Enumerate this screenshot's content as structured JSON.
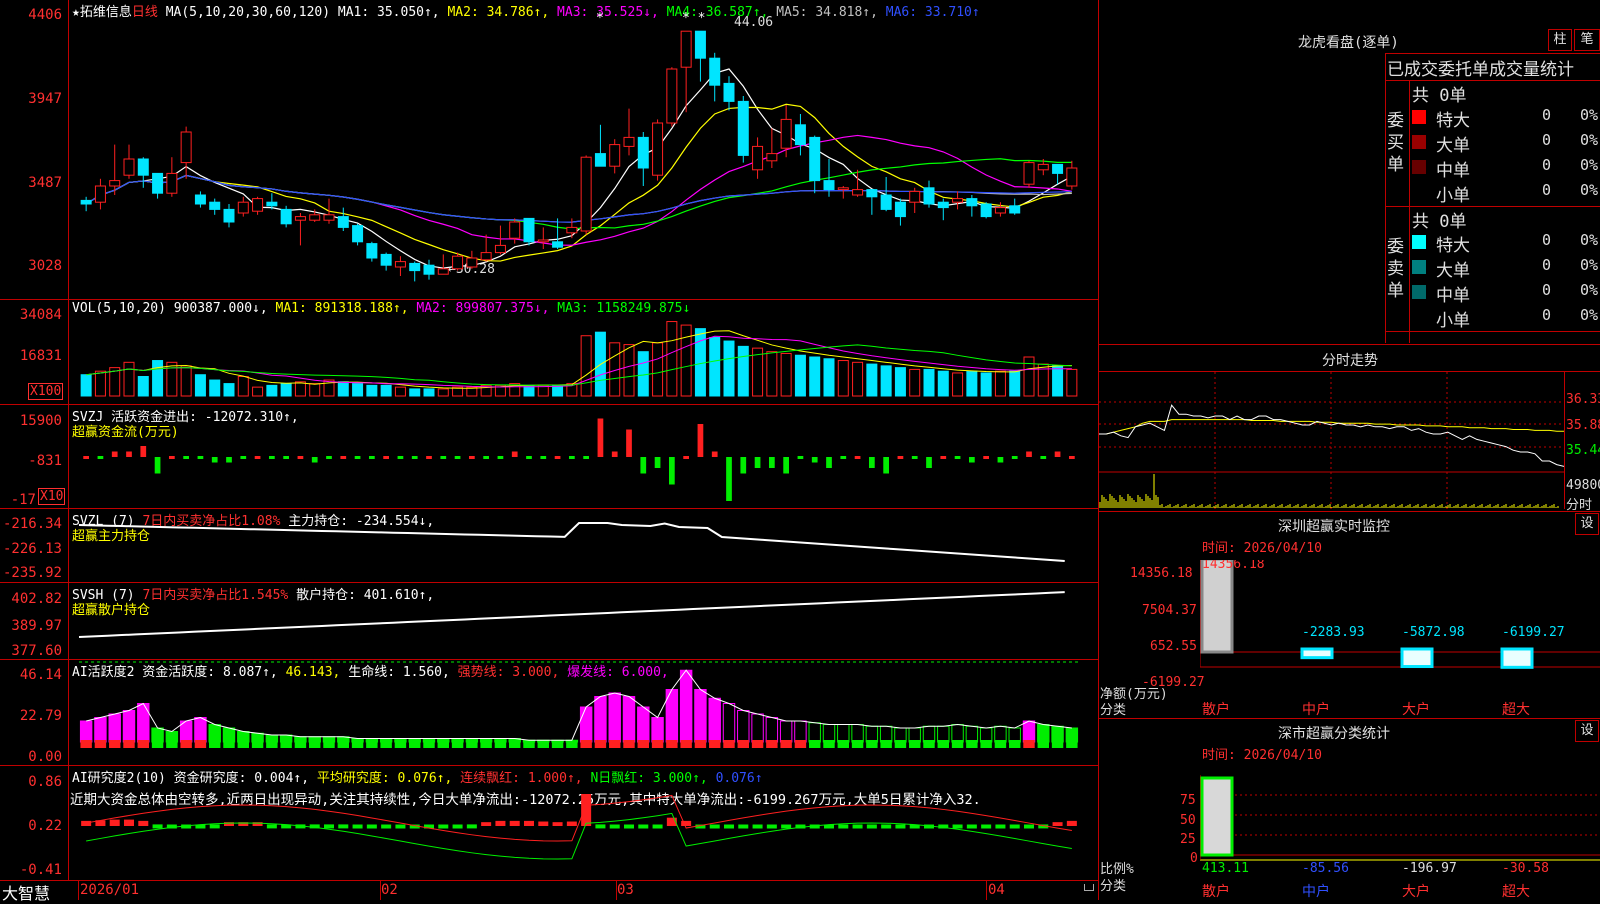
{
  "colors": {
    "up": "#ff2020",
    "down": "#00e5ff",
    "grid": "#c00000",
    "ma1": "#ffffff",
    "ma2": "#ffff00",
    "ma3": "#ff00ff",
    "ma4": "#00ff00",
    "ma5": "#c0c0c0",
    "ma6": "#3050ff",
    "green": "#00ee00",
    "magenta": "#ff00ff",
    "yellow": "#ffff00"
  },
  "main_chart": {
    "star": "★",
    "stock_name": "拓维信息",
    "period": "日线",
    "ma_params": "MA(5,10,20,30,60,120)",
    "ma1": "MA1: 35.050↑,",
    "ma2": "MA2: 34.786↑,",
    "ma3": "MA3: 35.525↓,",
    "ma4": "MA4: 36.587↑,",
    "ma5": "MA5: 34.818↑,",
    "ma6": "MA6: 33.710↑",
    "yticks": [
      "4406",
      "3947",
      "3487",
      "3028"
    ],
    "high_mark": "44.06",
    "low_mark": "←30.28",
    "star_marks": [
      "*",
      "* *"
    ]
  },
  "vol_panel": {
    "params": "VOL(5,10,20)",
    "value": "900387.000↓,",
    "ma1": "MA1: 891318.188↑,",
    "ma2": "MA2: 899807.375↓,",
    "ma3": "MA3: 1158249.875↓",
    "yticks": [
      "34084",
      "16831"
    ],
    "unit": "X100"
  },
  "svzj_panel": {
    "title": "SVZJ  活跃资金进出: -12072.310↑,",
    "subtitle": "超赢资金流(万元)",
    "yticks": [
      "15900",
      "-831",
      "-17"
    ],
    "unit": "X10"
  },
  "svzl_panel": {
    "title_a": "SVZL (7)",
    "title_b": "7日内买卖净占比1.08%",
    "title_c": "主力持仓: -234.554↓,",
    "subtitle": "超赢主力持仓",
    "yticks": [
      "-216.34",
      "-226.13",
      "-235.92"
    ]
  },
  "svsh_panel": {
    "title_a": "SVSH (7)",
    "title_b": "7日内买卖净占比1.545%",
    "title_c": "散户持仓: 401.610↑,",
    "subtitle": "超赢散户持仓",
    "yticks": [
      "402.82",
      "389.97",
      "377.60"
    ]
  },
  "ai2_panel": {
    "t1": "AI活跃度2 资金活跃度: 8.087↑,",
    "t2": "46.143,",
    "t3": "生命线: 1.560,",
    "t4": "强势线: 3.000,",
    "t5": "爆发线: 6.000,",
    "yticks": [
      "46.14",
      "22.79",
      "0.00"
    ]
  },
  "ai_research": {
    "t1": "AI研究度2(10) 资金研究度: 0.004↑,",
    "t2": "平均研究度: 0.076↑,",
    "t3": "连续飘红: 1.000↑,",
    "t4": "N日飘红: 3.000↑,",
    "t5": "0.076↑",
    "comment": "近期大资金总体由空转多,近两日出现异动,关注其持续性,今日大单净流出:-12072.25万元,其中特大单净流出:-6199.267万元,大单5日累计净入32.",
    "yticks": [
      "0.86",
      "0.22",
      "-0.41"
    ]
  },
  "x_axis": {
    "labels": [
      "2026/01",
      "02",
      "03",
      "04"
    ]
  },
  "brand": "大智慧",
  "dragon_tiger": {
    "title": "龙虎看盘(逐单)",
    "btn1": "柱",
    "btn2": "笔",
    "table_title": "已成交委托单成交量统计",
    "buy": {
      "side": "委买单",
      "total": "共 0单",
      "rows": [
        {
          "label": "特大",
          "value": "0",
          "pct": "0%",
          "color": "#ff0000"
        },
        {
          "label": "大单",
          "value": "0",
          "pct": "0%",
          "color": "#990000"
        },
        {
          "label": "中单",
          "value": "0",
          "pct": "0%",
          "color": "#660000"
        },
        {
          "label": "小单",
          "value": "0",
          "pct": "0%",
          "color": "#000000"
        }
      ]
    },
    "sell": {
      "side": "委卖单",
      "total": "共 0单",
      "rows": [
        {
          "label": "特大",
          "value": "0",
          "pct": "0%",
          "color": "#00ffff"
        },
        {
          "label": "大单",
          "value": "0",
          "pct": "0%",
          "color": "#008080"
        },
        {
          "label": "中单",
          "value": "0",
          "pct": "0%",
          "color": "#006a6a"
        },
        {
          "label": "小单",
          "value": "0",
          "pct": "0%",
          "color": "#000000"
        }
      ]
    }
  },
  "intraday": {
    "title": "分时走势",
    "yticks": [
      "36.33",
      "35.88",
      "35.44"
    ],
    "vol_tick": "49800",
    "vol_unit": "分时"
  },
  "sz_monitor": {
    "title": "深圳超赢实时监控",
    "btn": "设",
    "time": "时间: 2026/04/10",
    "yticks": [
      "14356.18",
      "7504.37",
      "652.55",
      "-6199.27"
    ],
    "ylabel": "净额(万元)",
    "xlabel": "分类",
    "bars": [
      {
        "label": "散户",
        "value": 14356.18,
        "text": "14356.18"
      },
      {
        "label": "中户",
        "value": -2283.93,
        "text": "-2283.93"
      },
      {
        "label": "大户",
        "value": -5872.98,
        "text": "-5872.98"
      },
      {
        "label": "超大",
        "value": -6199.27,
        "text": "-6199.27"
      }
    ]
  },
  "sz_class": {
    "title": "深市超赢分类统计",
    "btn": "设",
    "time": "时间: 2026/04/10",
    "yticks": [
      "75",
      "50",
      "25",
      "0"
    ],
    "ylabel": "比例%",
    "xlabel": "分类",
    "bars": [
      {
        "label": "散户",
        "value": 413.11,
        "text": "413.11"
      },
      {
        "label": "中户",
        "value": -85.56,
        "text": "-85.56"
      },
      {
        "label": "大户",
        "value": -196.97,
        "text": "-196.97"
      },
      {
        "label": "超大",
        "value": -30.58,
        "text": "-30.58"
      }
    ]
  },
  "chart_data": {
    "type": "candlestick",
    "title": "拓维信息 日线",
    "x": [
      "2026/01",
      "02",
      "03",
      "04"
    ],
    "series": [
      {
        "name": "K",
        "values": [
          [
            34.7,
            34.5,
            34.9,
            34.1
          ],
          [
            34.6,
            35.5,
            35.9,
            34.2
          ],
          [
            35.5,
            35.8,
            37.8,
            35.0
          ],
          [
            36.1,
            37.0,
            37.8,
            35.9
          ],
          [
            37.0,
            36.1,
            37.1,
            35.4
          ],
          [
            36.2,
            35.1,
            36.2,
            34.8
          ],
          [
            35.1,
            36.2,
            37.1,
            34.9
          ],
          [
            36.8,
            38.5,
            38.8,
            35.9
          ],
          [
            35.0,
            34.5,
            35.2,
            34.3
          ],
          [
            34.6,
            34.2,
            34.8,
            33.9
          ],
          [
            34.2,
            33.5,
            34.5,
            33.2
          ],
          [
            34.0,
            34.6,
            34.9,
            33.8
          ],
          [
            34.1,
            34.8,
            34.9,
            33.9
          ],
          [
            34.6,
            34.4,
            35.1,
            34.2
          ],
          [
            34.2,
            33.4,
            34.4,
            33.2
          ],
          [
            33.6,
            33.8,
            34.0,
            32.2
          ],
          [
            33.6,
            33.9,
            34.2,
            33.5
          ],
          [
            33.6,
            33.9,
            34.8,
            33.4
          ],
          [
            33.8,
            33.2,
            34.3,
            33.0
          ],
          [
            33.3,
            32.4,
            33.4,
            32.2
          ],
          [
            32.3,
            31.5,
            32.4,
            31.3
          ],
          [
            31.7,
            31.1,
            31.8,
            30.8
          ],
          [
            31.0,
            31.3,
            31.6,
            30.5
          ],
          [
            31.2,
            30.8,
            31.3,
            30.2
          ],
          [
            31.1,
            30.6,
            31.4,
            30.3
          ],
          [
            30.6,
            30.9,
            31.7,
            30.6
          ],
          [
            30.9,
            31.6,
            31.8,
            30.8
          ],
          [
            31.0,
            31.5,
            31.9,
            30.9
          ],
          [
            31.4,
            31.8,
            32.8,
            31.3
          ],
          [
            31.8,
            32.2,
            33.3,
            31.7
          ],
          [
            32.6,
            33.5,
            33.7,
            32.3
          ],
          [
            33.7,
            32.4,
            33.7,
            32.2
          ],
          [
            32.4,
            32.5,
            33.2,
            32.0
          ],
          [
            32.4,
            32.1,
            33.7,
            32.0
          ],
          [
            32.9,
            33.2,
            33.7,
            32.6
          ],
          [
            33.0,
            37.1,
            37.2,
            32.8
          ],
          [
            37.3,
            36.6,
            38.9,
            36.6
          ],
          [
            36.6,
            37.8,
            38.1,
            36.2
          ],
          [
            37.7,
            38.2,
            39.8,
            37.2
          ],
          [
            38.2,
            36.5,
            38.5,
            35.5
          ],
          [
            36.1,
            39.0,
            39.2,
            35.8
          ],
          [
            39.0,
            42.0,
            42.1,
            38.8
          ],
          [
            42.1,
            44.1,
            44.1,
            39.6
          ],
          [
            44.1,
            42.6,
            44.1,
            41.3
          ],
          [
            42.6,
            41.1,
            42.9,
            40.2
          ],
          [
            41.2,
            40.2,
            41.6,
            39.7
          ],
          [
            40.2,
            37.2,
            40.5,
            36.8
          ],
          [
            36.4,
            37.7,
            38.2,
            35.9
          ],
          [
            36.9,
            37.3,
            38.7,
            36.5
          ],
          [
            37.6,
            39.2,
            40.0,
            37.1
          ],
          [
            38.9,
            37.8,
            39.5,
            37.2
          ],
          [
            38.2,
            35.8,
            38.3,
            35.1
          ],
          [
            35.8,
            35.3,
            37.0,
            34.9
          ],
          [
            35.3,
            35.4,
            35.5,
            34.8
          ],
          [
            35.0,
            35.3,
            36.4,
            34.9
          ],
          [
            35.3,
            34.9,
            35.3,
            33.9
          ],
          [
            35.0,
            34.2,
            36.0,
            34.1
          ],
          [
            34.6,
            33.8,
            34.8,
            33.3
          ],
          [
            34.6,
            35.2,
            35.4,
            34.0
          ],
          [
            35.4,
            34.5,
            35.8,
            34.3
          ],
          [
            34.6,
            34.3,
            34.8,
            33.6
          ],
          [
            34.6,
            34.8,
            35.2,
            34.2
          ],
          [
            34.8,
            34.4,
            35.0,
            33.8
          ],
          [
            34.5,
            33.8,
            34.6,
            33.7
          ],
          [
            34.0,
            34.3,
            34.6,
            33.8
          ],
          [
            34.4,
            34.0,
            34.8,
            33.9
          ],
          [
            35.6,
            36.8,
            36.9,
            35.4
          ],
          [
            36.4,
            36.7,
            37.0,
            36.1
          ],
          [
            36.7,
            36.2,
            36.7,
            35.6
          ],
          [
            35.5,
            36.5,
            36.9,
            35.3
          ]
        ]
      }
    ],
    "ylim": [
      30.28,
      44.06
    ]
  },
  "vol_data": [
    12,
    14,
    16,
    19,
    11,
    20,
    19,
    17,
    12,
    9,
    7,
    11,
    5,
    6,
    7,
    8,
    7,
    9,
    8,
    7,
    6,
    6,
    5,
    4,
    4,
    4,
    5,
    5,
    6,
    6,
    7,
    6,
    6,
    6,
    7,
    34,
    36,
    30,
    29,
    25,
    30,
    42,
    40,
    38,
    33,
    31,
    28,
    27,
    25,
    24,
    23,
    22,
    21,
    20,
    19,
    18,
    17,
    16,
    15,
    15,
    14,
    13,
    14,
    13,
    14,
    14,
    22,
    18,
    17,
    15
  ],
  "svzj_data": [
    0,
    0,
    1,
    1,
    2,
    -3,
    0,
    0,
    0,
    -1,
    -1,
    0,
    0,
    0,
    0,
    0,
    -1,
    0,
    0,
    0,
    0,
    0,
    0,
    0,
    0,
    0,
    0,
    0,
    0,
    0,
    1,
    0,
    0,
    0,
    0,
    0,
    7,
    1,
    5,
    -3,
    -2,
    -5,
    0,
    6,
    1,
    -8,
    -3,
    -2,
    -2,
    -3,
    0,
    -1,
    -2,
    0,
    0,
    -2,
    -3,
    0,
    0,
    -2,
    0,
    0,
    -1,
    0,
    -1,
    0,
    1,
    0,
    1,
    0
  ],
  "ai2_data": [
    12,
    14,
    16,
    18,
    22,
    8,
    6,
    12,
    14,
    10,
    8,
    6,
    5,
    4,
    4,
    3,
    3,
    3,
    3,
    2,
    2,
    2,
    2,
    2,
    2,
    2,
    2,
    2,
    2,
    2,
    2,
    1,
    1,
    1,
    1,
    20,
    26,
    28,
    26,
    20,
    14,
    30,
    41,
    30,
    25,
    22,
    18,
    16,
    14,
    12,
    12,
    11,
    10,
    10,
    10,
    9,
    9,
    8,
    8,
    9,
    9,
    10,
    9,
    8,
    9,
    8,
    12,
    10,
    9,
    8
  ],
  "ai_res_data": [
    0.08,
    0.09,
    0.1,
    0.1,
    0.08,
    0.05,
    0.04,
    0.03,
    0.04,
    0.05,
    0.06,
    0.06,
    0.06,
    0.05,
    0.05,
    0.05,
    0.05,
    0.05,
    0.05,
    0.04,
    0.04,
    0.04,
    0.04,
    0.04,
    0.04,
    0.04,
    0.04,
    0.05,
    0.06,
    0.08,
    0.08,
    0.08,
    0.07,
    0.06,
    0.07,
    0.5,
    0.05,
    0.03,
    0.04,
    0.04,
    0.04,
    0.13,
    0.08,
    0.04,
    0.03,
    0.02,
    0.02,
    0.02,
    0.02,
    0.02,
    0.02,
    0.02,
    0.02,
    0.02,
    0.02,
    0.02,
    0.02,
    0.02,
    0.02,
    0.02,
    0.02,
    0.02,
    0.02,
    0.02,
    0.02,
    0.02,
    0.03,
    0.05,
    0.06,
    0.08
  ],
  "intraday_data": [
    35.8,
    35.8,
    35.82,
    35.78,
    35.76,
    35.88,
    35.9,
    35.92,
    35.88,
    35.84,
    36.12,
    36.02,
    36.02,
    36.0,
    36.0,
    35.98,
    36.0,
    36.0,
    35.96,
    36.0,
    35.96,
    35.96,
    36.0,
    36.0,
    35.96,
    35.96,
    35.94,
    35.92,
    35.9,
    35.9,
    35.94,
    35.92,
    35.9,
    35.92,
    35.9,
    35.9,
    35.88,
    35.9,
    35.88,
    35.88,
    35.86,
    35.88,
    35.88,
    35.84,
    35.86,
    35.82,
    35.8,
    35.8,
    35.82,
    35.78,
    35.74,
    35.78,
    35.74,
    35.72,
    35.7,
    35.68,
    35.66,
    35.62,
    35.6,
    35.6,
    35.58,
    35.5,
    35.5,
    35.46,
    35.44
  ],
  "intraday_avg": [
    35.8,
    35.8,
    35.82,
    35.84,
    35.86,
    35.88,
    35.92,
    35.94,
    35.94,
    35.94,
    35.96,
    35.96,
    35.96,
    35.96,
    35.96,
    35.96,
    35.96,
    35.96,
    35.96,
    35.96,
    35.96,
    35.95,
    35.95,
    35.95,
    35.95,
    35.94,
    35.94,
    35.94,
    35.94,
    35.94,
    35.93,
    35.93,
    35.93,
    35.92,
    35.92,
    35.92,
    35.92,
    35.92,
    35.91,
    35.91,
    35.91,
    35.9,
    35.9,
    35.9,
    35.9,
    35.89,
    35.89,
    35.89,
    35.88,
    35.88,
    35.88,
    35.87,
    35.87,
    35.87,
    35.86,
    35.86,
    35.86,
    35.85,
    35.85,
    35.85,
    35.84,
    35.84,
    35.84,
    35.83,
    35.83
  ]
}
